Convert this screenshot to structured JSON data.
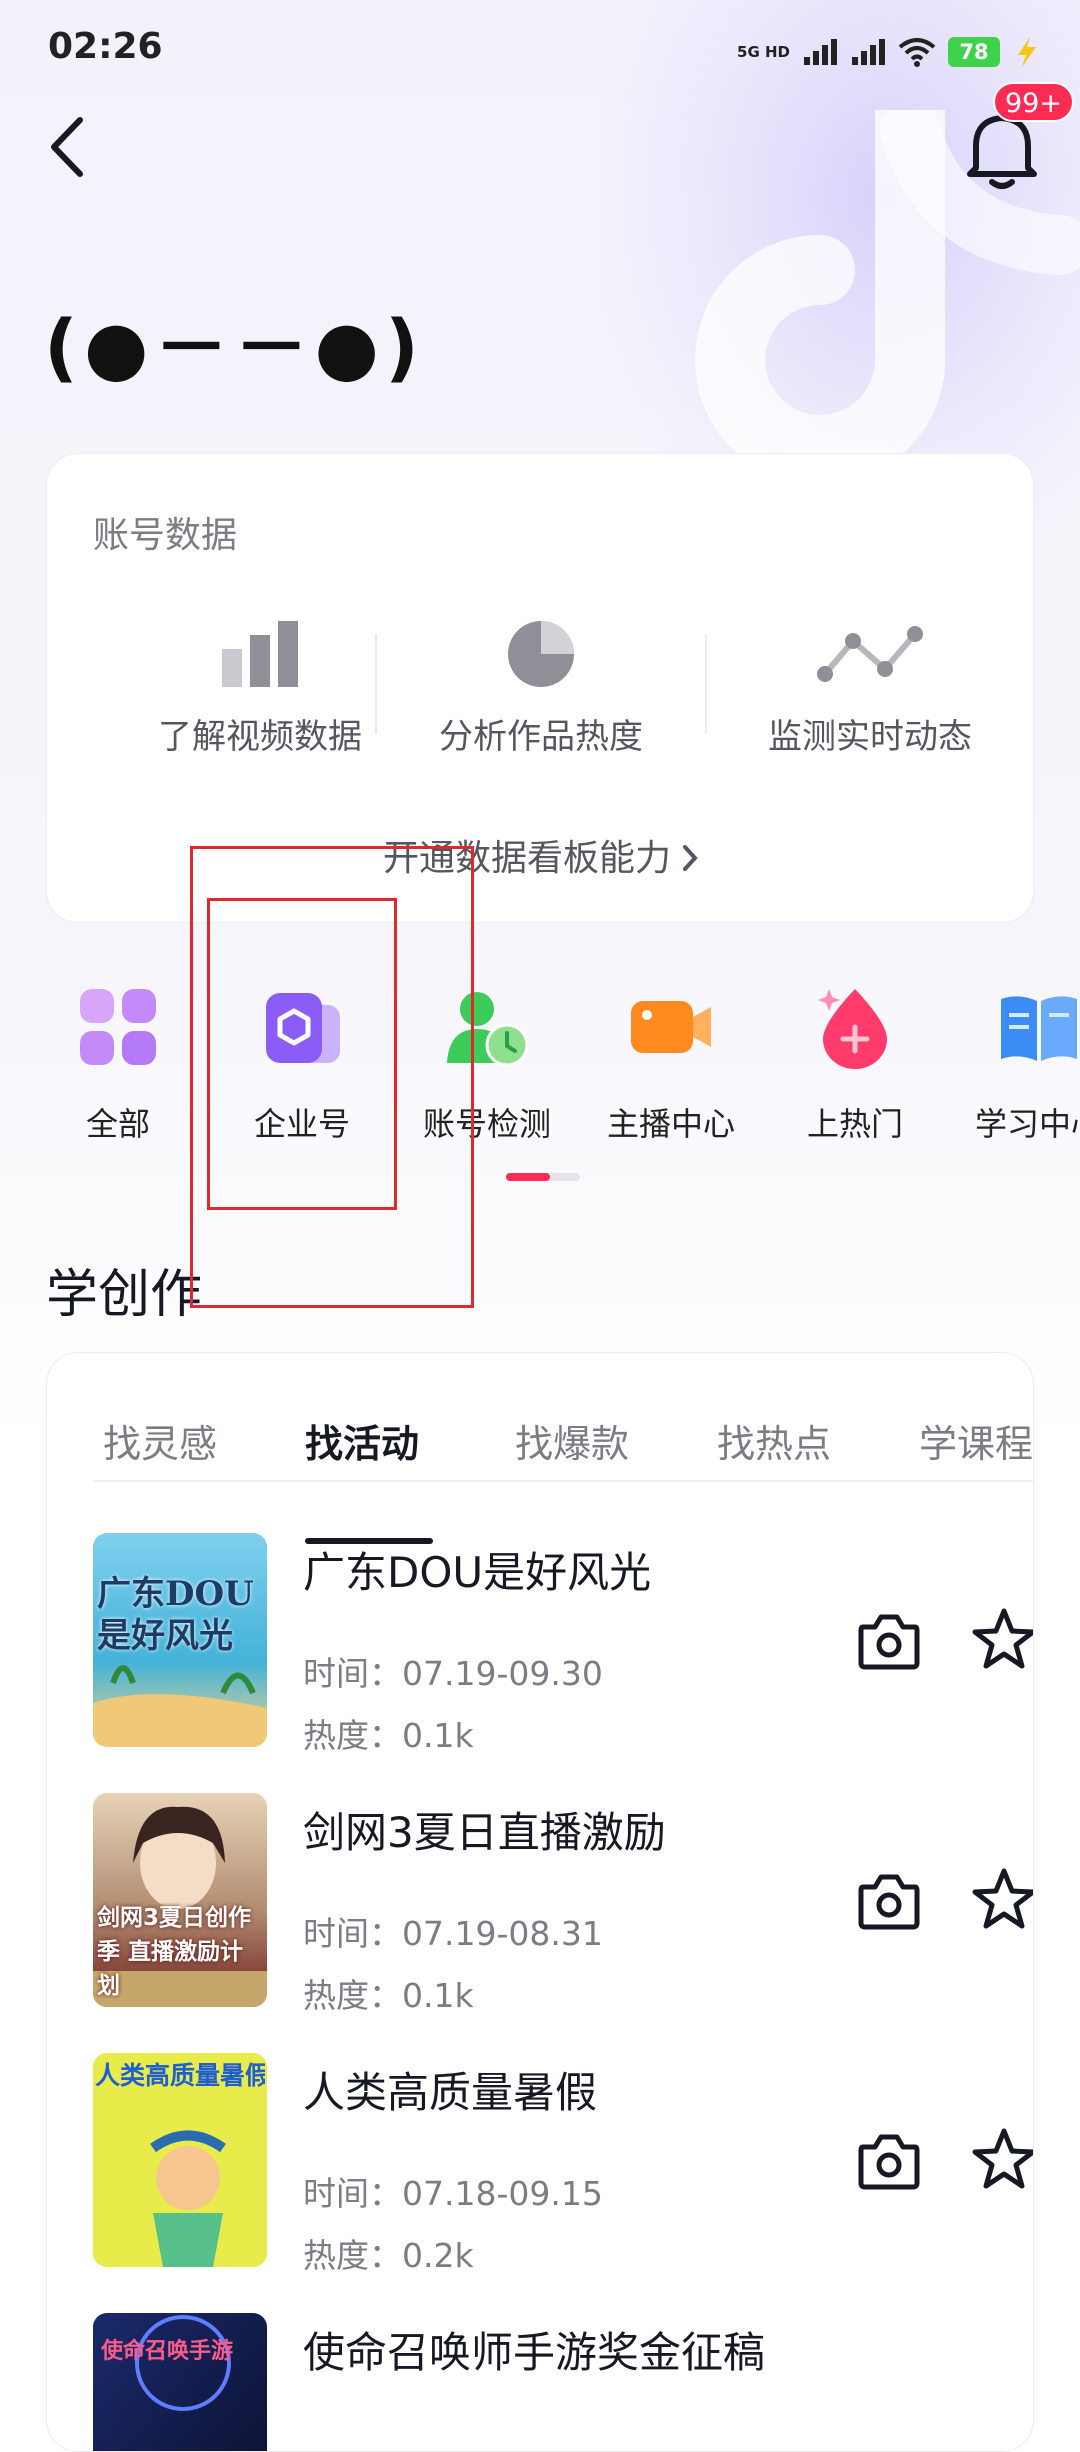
{
  "status_bar": {
    "time": "02:26",
    "network_top": "5G HD",
    "battery": "78",
    "icons": [
      "signal-5g-icon",
      "signal-bars-icon",
      "signal-bars-2-icon",
      "wifi-icon",
      "battery-icon",
      "charging-icon"
    ]
  },
  "header": {
    "notification_badge": "99+",
    "profile_name": "(●－－●)"
  },
  "account_data": {
    "title": "账号数据",
    "items": [
      {
        "label": "了解视频数据",
        "icon": "bar-chart-icon"
      },
      {
        "label": "分析作品热度",
        "icon": "pie-chart-icon"
      },
      {
        "label": "监测实时动态",
        "icon": "line-chart-icon"
      }
    ],
    "link": "开通数据看板能力"
  },
  "shortcuts": [
    {
      "label": "全部",
      "icon": "grid-icon",
      "color": "#c58af9"
    },
    {
      "label": "企业号",
      "icon": "enterprise-icon",
      "color": "#8b5cf6"
    },
    {
      "label": "账号检测",
      "icon": "account-check-icon",
      "color": "#3dcb5a"
    },
    {
      "label": "主播中心",
      "icon": "video-camera-icon",
      "color": "#ff8a1f"
    },
    {
      "label": "上热门",
      "icon": "trending-drop-icon",
      "color": "#ff3b6b"
    },
    {
      "label": "学习中心",
      "icon": "book-icon",
      "color": "#3b8cf5"
    }
  ],
  "section_title": "学创作",
  "tabs": [
    "找灵感",
    "找活动",
    "找爆款",
    "找热点",
    "学课程"
  ],
  "active_tab": "找活动",
  "activities": [
    {
      "title": "广东DOU是好风光",
      "time": "时间：07.19-09.30",
      "heat": "热度：0.1k",
      "thumb_text": "广东DOU是好风光"
    },
    {
      "title": "剑网3夏日直播激励",
      "time": "时间：07.19-08.31",
      "heat": "热度：0.1k",
      "thumb_text": "剑网3夏日创作季 直播激励计划"
    },
    {
      "title": "人类高质量暑假",
      "time": "时间：07.18-09.15",
      "heat": "热度：0.2k",
      "thumb_text": "人类高质量暑假"
    },
    {
      "title": "使命召唤师手游奖金征稿",
      "time": "",
      "heat": "",
      "thumb_text": "使命召唤手游"
    }
  ],
  "colors": {
    "accent": "#fe2c55",
    "highlight": "#e0292f"
  }
}
